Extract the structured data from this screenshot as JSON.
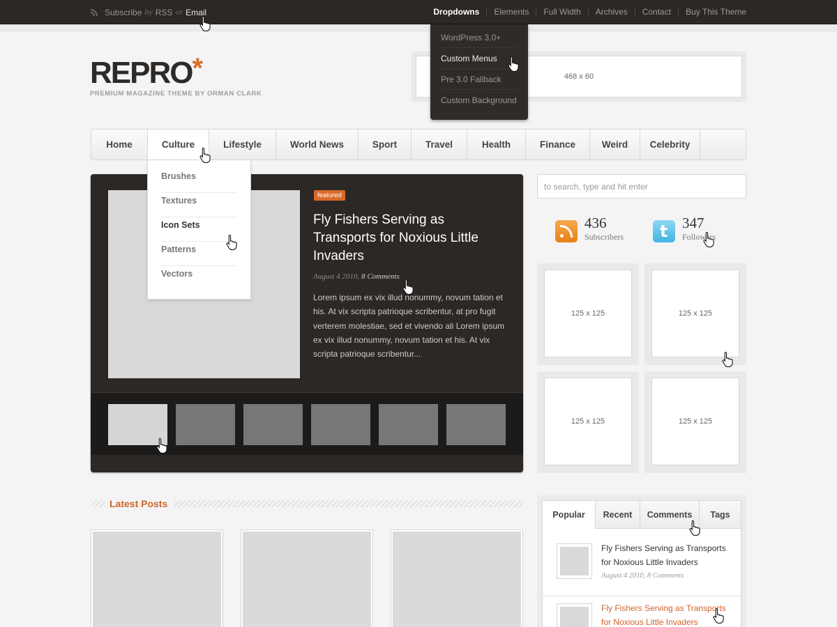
{
  "topbar": {
    "subscribe": {
      "prefix": "Subscribe",
      "by": "by",
      "rss": "RSS",
      "or": "or",
      "email": "Email"
    },
    "nav": [
      "Dropdowns",
      "Elements",
      "Full Width",
      "Archives",
      "Contact",
      "Buy This Theme"
    ],
    "dropdown": [
      "WordPress 3.0+",
      "Custom Menus",
      "Pre 3.0 Fallback",
      "Custom Background"
    ]
  },
  "header": {
    "logo": "REPRO",
    "logo_mark": "*",
    "tagline": "PREMIUM MAGAZINE THEME BY ORMAN CLARK",
    "banner_label": "468 x 60"
  },
  "mainnav": {
    "items": [
      "Home",
      "Culture",
      "Lifestyle",
      "World News",
      "Sport",
      "Travel",
      "Health",
      "Finance",
      "Weird",
      "Celebrity"
    ],
    "culture_dropdown": [
      "Brushes",
      "Textures",
      "Icon Sets",
      "Patterns",
      "Vectors"
    ]
  },
  "featured": {
    "badge": "featured",
    "title": "Fly Fishers Serving as Transports for Noxious Little Invaders",
    "date": "August 4 2010,",
    "comments": "8 Comments",
    "excerpt": "Lorem ipsum ex vix illud nonummy, novum tation et his. At vix scripta patrioque scribentur, at pro fugit verterem molestiae, sed et vivendo ali Lorem ipsum ex vix illud nonummy, novum tation et his. At vix scripta patrioque scribentur..."
  },
  "sidebar": {
    "search_placeholder": "to search, type and hit enter",
    "subscribers": {
      "count": "436",
      "label": "Subscribers"
    },
    "followers": {
      "count": "347",
      "label": "Followers"
    },
    "ad_label": "125 x 125"
  },
  "latest": {
    "title": "Latest Posts"
  },
  "tabs": {
    "labels": [
      "Popular",
      "Recent",
      "Comments",
      "Tags"
    ],
    "posts": [
      {
        "title": "Fly Fishers Serving as Transports for Noxious Little Invaders",
        "meta": "August 4 2010, 8 Comments"
      },
      {
        "title": "Fly Fishers Serving as Transports for Noxious Little Invaders"
      }
    ]
  },
  "colors": {
    "accent": "#d86b2b",
    "dark": "#2c2826"
  }
}
